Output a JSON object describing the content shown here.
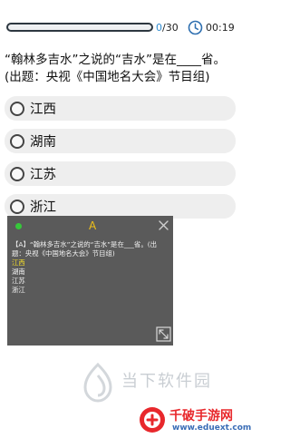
{
  "header": {
    "progress_current": "0",
    "progress_total": "/30",
    "progress_fraction": 0,
    "timer": "00:19",
    "icons": {
      "timer": "clock-icon"
    }
  },
  "question": {
    "line1": "“翰林多吉水”之说的“吉水”是在____省。",
    "line2": "(出题：央视《中国地名大会》节目组)"
  },
  "options": [
    {
      "label": "江西"
    },
    {
      "label": "湖南"
    },
    {
      "label": "江苏"
    },
    {
      "label": "浙江"
    }
  ],
  "floating_window": {
    "font_button": "A",
    "question": "【A】“翰林多吉水”之说的“吉水”是在___省。(出题：央视《中国地名大会》节目组)",
    "options": [
      {
        "label": "江西",
        "highlighted": true
      },
      {
        "label": "湖南",
        "highlighted": false
      },
      {
        "label": "江苏",
        "highlighted": false
      },
      {
        "label": "浙江",
        "highlighted": false
      }
    ],
    "colors": {
      "background": "#5a5a5a",
      "highlight": "#f3dc2a",
      "dot": "#36c83a"
    }
  },
  "watermarks": {
    "site1": "当下软件园",
    "site2_title": "千破手游网",
    "site2_url": "www.eduext.com"
  }
}
